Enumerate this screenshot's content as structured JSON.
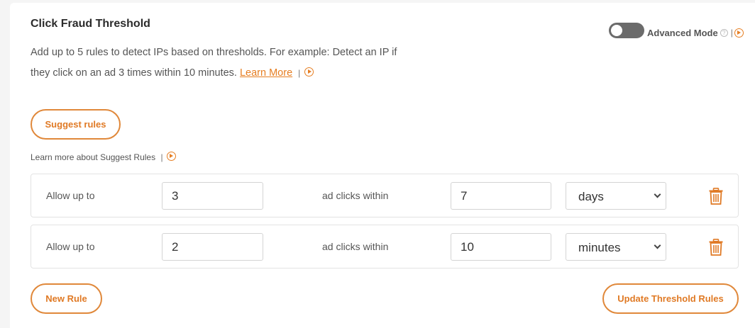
{
  "header": {
    "title": "Click Fraud Threshold",
    "description_text": "Add up to 5 rules to detect IPs based on thresholds. For example: Detect an IP if they click on an ad 3 times within 10 minutes.",
    "learn_more_link": "Learn More",
    "separator": "|"
  },
  "advanced_mode": {
    "label": "Advanced Mode",
    "enabled": false,
    "help_glyph": "?",
    "separator": "|"
  },
  "suggest": {
    "button_label": "Suggest rules",
    "learn_text": "Learn more about Suggest Rules",
    "separator": "|"
  },
  "rules": [
    {
      "prefix": "Allow up to",
      "count": "3",
      "middle": "ad clicks within",
      "window": "7",
      "unit": "days"
    },
    {
      "prefix": "Allow up to",
      "count": "2",
      "middle": "ad clicks within",
      "window": "10",
      "unit": "minutes"
    }
  ],
  "actions": {
    "new_rule_label": "New Rule",
    "update_label": "Update Threshold Rules"
  },
  "colors": {
    "accent": "#e07a25",
    "toggle_off": "#6b6b6b",
    "border": "#e3e3e3"
  },
  "icons": {
    "video": "play-circle-icon",
    "help": "question-circle-icon",
    "delete": "trash-icon",
    "dropdown": "chevron-down-icon"
  }
}
